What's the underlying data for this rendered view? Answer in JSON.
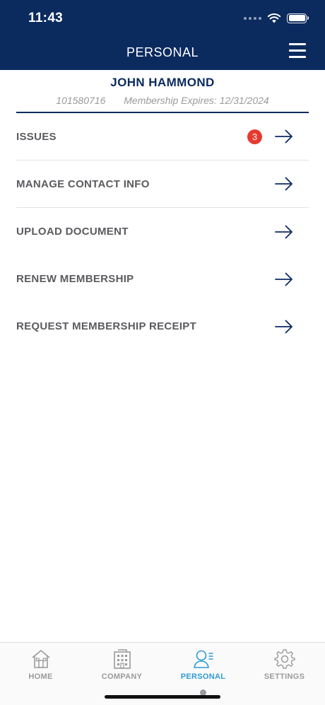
{
  "status_bar": {
    "time": "11:43"
  },
  "header": {
    "title": "PERSONAL"
  },
  "profile": {
    "name": "JOHN HAMMOND",
    "member_id": "101580716",
    "expiry": "Membership Expires: 12/31/2024"
  },
  "menu": {
    "items": [
      {
        "label": "ISSUES",
        "badge": "3"
      },
      {
        "label": "MANAGE CONTACT INFO"
      },
      {
        "label": "UPLOAD DOCUMENT"
      },
      {
        "label": "RENEW MEMBERSHIP"
      },
      {
        "label": "REQUEST MEMBERSHIP RECEIPT"
      }
    ]
  },
  "tabbar": {
    "items": [
      {
        "label": "HOME",
        "icon": "home-icon"
      },
      {
        "label": "COMPANY",
        "icon": "building-icon"
      },
      {
        "label": "PERSONAL",
        "icon": "person-icon",
        "active": true
      },
      {
        "label": "SETTINGS",
        "icon": "gear-icon"
      }
    ]
  },
  "colors": {
    "header_bg": "#0b2a5e",
    "accent_active": "#2e9ad8",
    "badge": "#e8392f",
    "label_gray": "#5b5b60"
  }
}
